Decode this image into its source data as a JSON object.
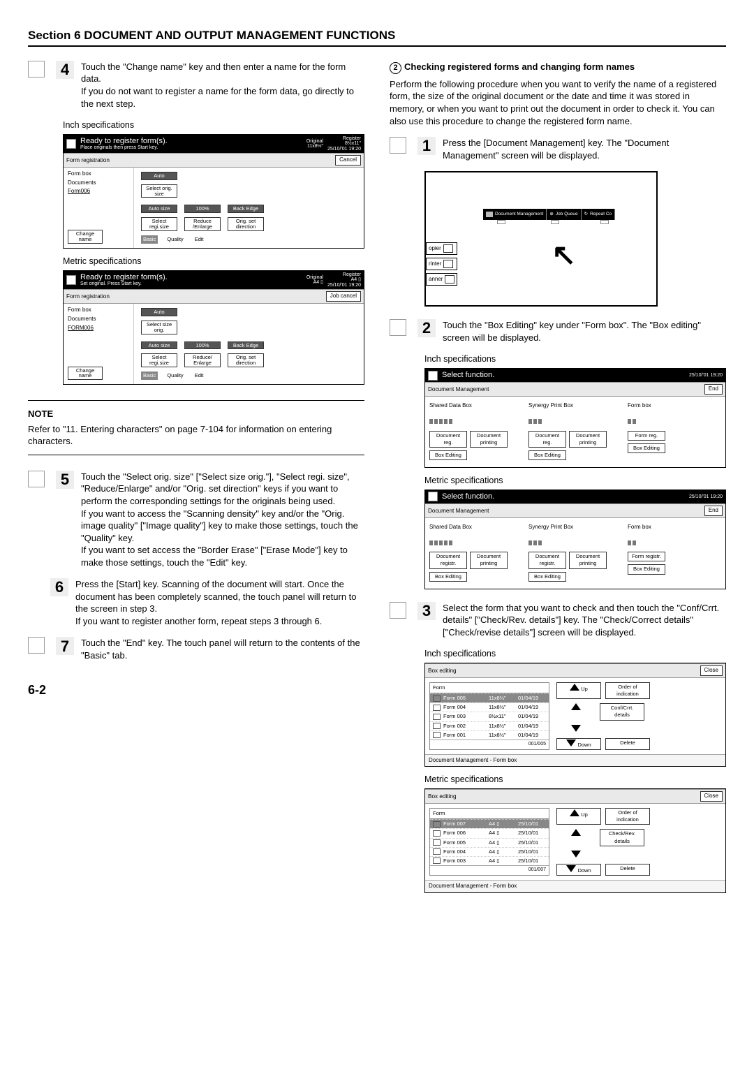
{
  "section_title": "Section 6  DOCUMENT AND OUTPUT MANAGEMENT FUNCTIONS",
  "page_number": "6-2",
  "left": {
    "step4": {
      "num": "4",
      "p1": "Touch the \"Change name\" key and then enter a name for the form data.",
      "p2": "If you do not want to register a name for the form data, go directly to the next step.",
      "inch_label": "Inch specifications",
      "metric_label": "Metric specifications"
    },
    "screen_inch": {
      "title": "Ready to register form(s).",
      "sub": "Place originals then press Start key.",
      "orig_label": "Original",
      "orig_val": "11x8½\"",
      "reg_label": "Register",
      "reg_val": "8½x11\"",
      "ts": "25/10/'01  19:20",
      "tab": "Form registration",
      "cancel": "Cancel",
      "items": [
        "Form box",
        "Documents",
        "Form006"
      ],
      "auto": "Auto",
      "select_orig": "Select\norig. size",
      "auto_size": "Auto size",
      "hundred": "100%",
      "back_edge": "Back Edge",
      "select_regi": "Select\nregi.size",
      "reduce": "Reduce\n/Enlarge",
      "orig_dir": "Orig. set\ndirection",
      "change_name": "Change\nname",
      "basic": "Basic",
      "quality": "Quality",
      "edit": "Edit"
    },
    "screen_metric": {
      "title": "Ready to register form(s).",
      "sub": "Set original. Press Start key.",
      "orig_label": "Original",
      "orig_val": "A4 ▯",
      "reg_label": "Register",
      "reg_val": "A4 ▯",
      "ts": "25/10/'01  19:20",
      "tab": "Form registration",
      "cancel": "Job cancel",
      "items": [
        "Form box",
        "Documents",
        "FORM006"
      ],
      "auto": "Auto",
      "select_orig": "Select\nsize orig.",
      "auto_size": "Auto size",
      "hundred": "100%",
      "back_edge": "Back Edge",
      "select_regi": "Select\nregi.size",
      "reduce": "Reduce/\nEnlarge",
      "orig_dir": "Orig. set\ndirection",
      "change_name": "Change\nname",
      "basic": "Basic",
      "quality": "Quality",
      "edit": "Edit"
    },
    "note": {
      "head": "NOTE",
      "body": "Refer to \"11. Entering characters\" on page 7-104 for information on entering characters."
    },
    "step5": {
      "num": "5",
      "p1": "Touch the \"Select orig. size\" [\"Select size orig.\"], \"Select regi. size\", \"Reduce/Enlarge\" and/or \"Orig. set direction\" keys if you want to perform the corresponding settings for the originals being used.",
      "p2": "If you want to access the \"Scanning density\" key and/or the \"Orig. image quality\" [\"Image quality\"] key to make those settings, touch the \"Quality\" key.",
      "p3": "If you want to set access the \"Border Erase\" [\"Erase Mode\"] key to make those settings, touch the \"Edit\" key."
    },
    "step6": {
      "num": "6",
      "p1": "Press the [Start] key. Scanning of the document will start. Once the document has been completely scanned, the touch panel will return to the screen in step 3.",
      "p2": "If you want to register another form, repeat steps 3 through 6."
    },
    "step7": {
      "num": "7",
      "p1": "Touch the \"End\" key. The touch panel will return to the contents of the \"Basic\" tab."
    }
  },
  "right": {
    "sub_title_num": "2",
    "sub_title": "Checking registered forms and changing form names",
    "intro": "Perform the following procedure when you want to verify the name of a registered form, the size of the original document or the date and time it was stored in memory, or when you want to print out the document in order to check it. You can also use this procedure to change the registered form name.",
    "step1": {
      "num": "1",
      "text": "Press the [Document Management] key. The \"Document Management\" screen will be displayed."
    },
    "hw": {
      "docmgmt": "Document\nManagement",
      "jobq": "Job Queue",
      "repeat": "Repeat Co",
      "side": [
        "opier",
        "rinter",
        "anner"
      ]
    },
    "step2": {
      "num": "2",
      "p1": "Touch the \"Box Editing\" key under \"Form box\". The \"Box editing\" screen will be displayed.",
      "inch": "Inch specifications",
      "metric": "Metric specifications"
    },
    "sf_inch": {
      "title": "Select function.",
      "ts": "25/10/'01 19:20",
      "tab": "Document Management",
      "end": "End",
      "cols": {
        "c1": {
          "head": "Shared Data Box",
          "b1": "Document\nreg.",
          "b2": "Document\nprinting",
          "b3": "Box\nEditing"
        },
        "c2": {
          "head": "Synergy Print Box",
          "b1": "Document\nreg.",
          "b2": "Document\nprinting",
          "b3": "Box\nEditing"
        },
        "c3": {
          "head": "Form box",
          "b1": "Form\nreg.",
          "b3": "Box\nEditing"
        }
      }
    },
    "sf_metric": {
      "title": "Select function.",
      "ts": "25/10/'01   19:20",
      "tab": "Document Management",
      "end": "End",
      "cols": {
        "c1": {
          "head": "Shared Data Box",
          "b1": "Document\nregistr.",
          "b2": "Document\nprinting",
          "b3": "Box\nEditing"
        },
        "c2": {
          "head": "Synergy Print Box",
          "b1": "Document\nregistr.",
          "b2": "Document\nprinting",
          "b3": "Box\nEditing"
        },
        "c3": {
          "head": "Form box",
          "b1": "Form\nregistr.",
          "b3": "Box\nEditing"
        }
      }
    },
    "step3": {
      "num": "3",
      "text": "Select the form that you want to check and then touch the \"Conf/Crrt. details\" [\"Check/Rev. details\"] key. The \"Check/Correct details\" [\"Check/revise details\"] screen will be displayed.",
      "inch": "Inch specifications",
      "metric": "Metric specifications"
    },
    "be_inch": {
      "title": "Box editing",
      "close": "Close",
      "list_head": "Form",
      "rows": [
        {
          "n": "Form 005",
          "s": "11x8¼\"",
          "d": "01/04/19",
          "sel": true
        },
        {
          "n": "Form 004",
          "s": "11x8½\"",
          "d": "01/04/19"
        },
        {
          "n": "Form 003",
          "s": "8½x11\"",
          "d": "01/04/19"
        },
        {
          "n": "Form 002",
          "s": "11x8½\"",
          "d": "01/04/19"
        },
        {
          "n": "Form 001",
          "s": "11x8½\"",
          "d": "01/04/19"
        }
      ],
      "count": "001/005",
      "up": "Up",
      "down": "Down",
      "order": "Order of\nindication",
      "conf": "Conf/Crrt.\ndetails",
      "del": "Delete",
      "foot": "Document Management - Form box"
    },
    "be_metric": {
      "title": "Box editing",
      "close": "Close",
      "list_head": "Form",
      "rows": [
        {
          "n": "Form 007",
          "s": "A4 ▯",
          "d": "25/10/01",
          "sel": true
        },
        {
          "n": "Form 006",
          "s": "A4 ▯",
          "d": "25/10/01"
        },
        {
          "n": "Form 005",
          "s": "A4 ▯",
          "d": "25/10/01"
        },
        {
          "n": "Form 004",
          "s": "A4 ▯",
          "d": "25/10/01"
        },
        {
          "n": "Form 003",
          "s": "A4 ▯",
          "d": "25/10/01"
        }
      ],
      "count": "001/007",
      "up": "Up",
      "down": "Down",
      "order": "Order of\nindication",
      "conf": "Check/Rev.\ndetails",
      "del": "Delete",
      "foot": "Document Management - Form box"
    }
  }
}
